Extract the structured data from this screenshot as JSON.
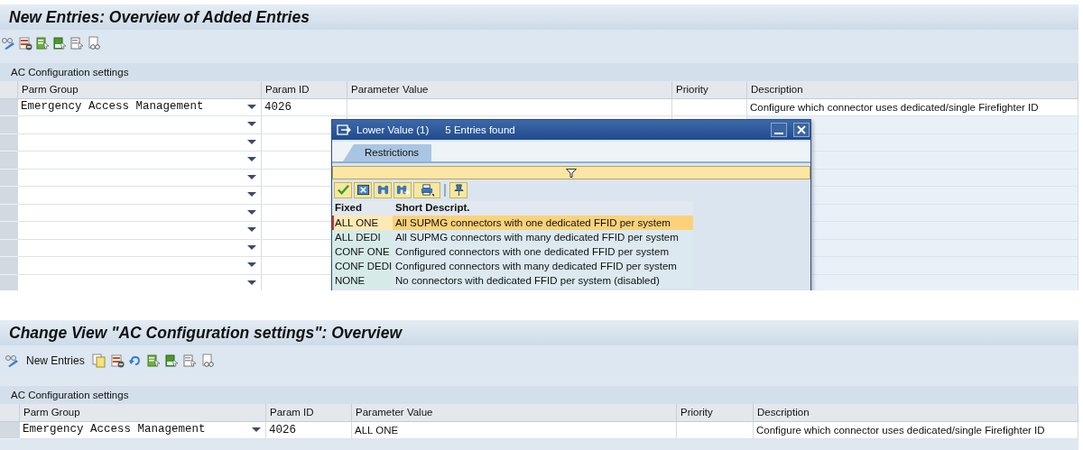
{
  "top_screen": {
    "title": "New Entries: Overview of Added Entries",
    "table": {
      "title": "AC Configuration settings",
      "columns": [
        "Parm Group",
        "Param ID",
        "Parameter Value",
        "Priority",
        "Description"
      ],
      "rows": [
        {
          "kind": "entry",
          "parm_group": "Emergency Access Management",
          "param_id": "4026",
          "description": "Configure which connector uses dedicated/single Firefighter ID"
        },
        {
          "kind": "empty"
        },
        {
          "kind": "empty"
        },
        {
          "kind": "empty"
        },
        {
          "kind": "empty"
        },
        {
          "kind": "empty"
        },
        {
          "kind": "empty"
        },
        {
          "kind": "empty"
        },
        {
          "kind": "empty"
        },
        {
          "kind": "empty"
        },
        {
          "kind": "empty"
        }
      ]
    },
    "popup": {
      "title": "Lower Value (1)",
      "count": "5 Entries found",
      "tabs": [
        {
          "label": "Restrictions",
          "selected": true
        }
      ],
      "columns": [
        "Fixed",
        "Short Descript."
      ],
      "rows": [
        {
          "fixed": "ALL ONE",
          "description": "All SUPMG connectors with one dedicated FFID per system",
          "selected": true
        },
        {
          "fixed": "ALL DEDI",
          "description": "All SUPMG connectors with many dedicated FFID per system",
          "selected": false
        },
        {
          "fixed": "CONF ONE",
          "description": "Configured connectors with one dedicated FFID per system",
          "selected": false
        },
        {
          "fixed": "CONF DEDI",
          "description": "Configured connectors with many dedicated FFID per system",
          "selected": false
        },
        {
          "fixed": "NONE",
          "description": "No connectors with dedicated FFID per system (disabled)",
          "selected": false
        }
      ]
    }
  },
  "bottom_screen": {
    "title": "Change View \"AC Configuration settings\": Overview",
    "new_entries_button": "New Entries",
    "table": {
      "title": "AC Configuration settings",
      "columns": [
        "Parm Group",
        "Param ID",
        "Parameter Value",
        "Priority",
        "Description"
      ],
      "rows": [
        {
          "kind": "entry",
          "parm_group": "Emergency Access Management",
          "param_id": "4026",
          "parameter_value": "ALL ONE",
          "description": "Configure which connector uses dedicated/single Firefighter ID"
        }
      ]
    }
  }
}
